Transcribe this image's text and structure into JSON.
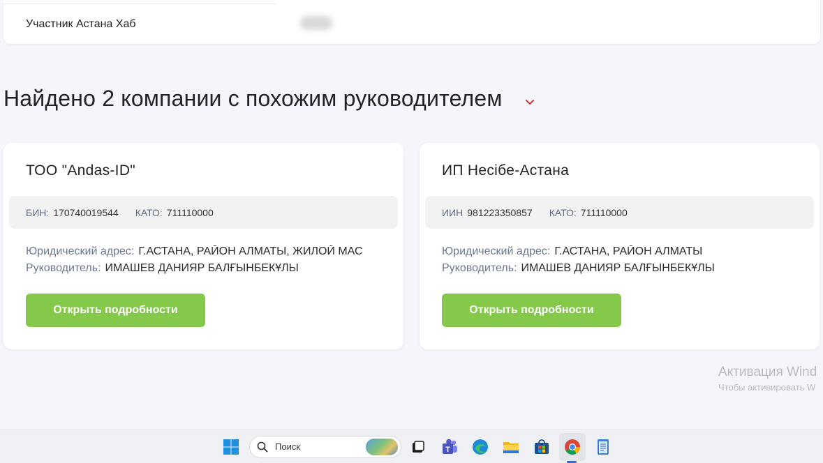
{
  "top_card": {
    "member_label": "Участник Астана Хаб"
  },
  "section": {
    "title": "Найдено 2 компании с похожим руководителем",
    "chevron_icon": "chevron-down-icon",
    "chevron_color": "#d9342b"
  },
  "companies": [
    {
      "name": "ТОО \"Andas-ID\"",
      "id_key": "БИН:",
      "id_value": "170740019544",
      "kato_key": "КАТО:",
      "kato_value": "711110000",
      "address_key": "Юридический адрес:",
      "address_value": "Г.АСТАНА, РАЙОН АЛМАТЫ, ЖИЛОЙ МАС",
      "head_key": "Руководитель:",
      "head_value": "ИМАШЕВ ДАНИЯР БАЛҒЫНБЕКҰЛЫ",
      "button_label": "Открыть подробности"
    },
    {
      "name": "ИП Несібе-Астана",
      "id_key": "ИИН",
      "id_value": "981223350857",
      "kato_key": "КАТО:",
      "kato_value": "711110000",
      "address_key": "Юридический адрес:",
      "address_value": "Г.АСТАНА, РАЙОН АЛМАТЫ",
      "head_key": "Руководитель:",
      "head_value": "ИМАШЕВ ДАНИЯР БАЛҒЫНБЕКҰЛЫ",
      "button_label": "Открыть подробности"
    }
  ],
  "watermark": {
    "line1": "Активация Wind",
    "line2": "Чтобы активировать W"
  },
  "taskbar": {
    "search_placeholder": "Поиск",
    "accent_color": "#85c94b",
    "icons": [
      "windows-start-icon",
      "search-icon",
      "task-view-icon",
      "teams-icon",
      "edge-icon",
      "file-explorer-icon",
      "store-icon",
      "chrome-icon",
      "notepad-icon"
    ]
  }
}
